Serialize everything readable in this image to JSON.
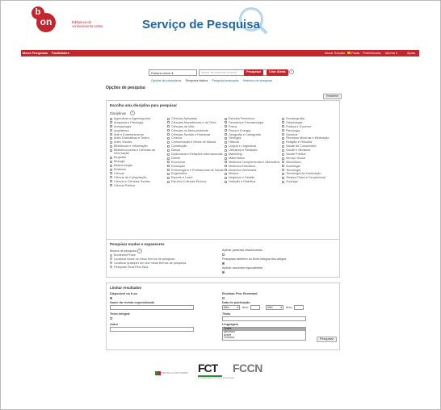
{
  "header": {
    "logo_b": "b",
    "logo_on": "on",
    "logo_line1": "Biblioteca do",
    "logo_line2": "conhecimento online",
    "title": "Serviço de Pesquisa"
  },
  "nav": {
    "left": [
      "Meus Pesquisas",
      "Facilidades"
    ],
    "right": [
      "Iniciar Sessão",
      "Pasta",
      "Preferências",
      "Idioma ▾",
      "Ajuda"
    ]
  },
  "search": {
    "select_value": "Palavra-chave ▾",
    "placeholder": "Inserir as palavras-chaves",
    "search_button": "Pesquisar",
    "alert_button": "Criar Alerta",
    "help": "?"
  },
  "sub_links": [
    "Opções de pesquisa ▸",
    "Pesquisa básica",
    "Pesquisa avançada",
    "Histórico de pesquisa"
  ],
  "options_heading": "Opções de pesquisa",
  "reset_button": "Redefinir",
  "disciplines": {
    "title": "Escolha uma disciplina para pesquisar",
    "label": "Disciplinas",
    "help": "?",
    "col1": [
      "Agricultura e Agronegócios",
      "Anatomia e Fisiologia",
      "Antropologia",
      "Arquitetura",
      "Arte e Entretenimento",
      "Artes Dramáticas e Teatro",
      "Artes Visuais",
      "Bibliotecas e Informação",
      "Biblioteconomia e Ciências da Informação",
      "Biografia",
      "Biologia",
      "Biotecnologia",
      "Botânica",
      "Ciência",
      "Ciência da Computação",
      "Ciência e Ciências Sociais",
      "Ciência Política"
    ],
    "col2": [
      "Ciências Aplicadas",
      "Ciências Atmosféricas e da Terra",
      "Ciências da Vida",
      "Ciências do Meio-ambiente",
      "Ciências Sociais e Humanas",
      "Cinema",
      "Comunicação e Meios de Massa",
      "Construção",
      "Dança",
      "Diplomacia e Relações Internacionais",
      "Direito",
      "Economia",
      "Educação",
      "Enfermagem e Profissionais de Saúde",
      "Engenharia",
      "Esporte e Lazer",
      "Estudos Culturais Étnicos"
    ],
    "col3": [
      "Estudos Femininos",
      "Farmácia e Farmacologia",
      "Física",
      "Fisica e Energia",
      "Geografia e Cartografia",
      "Geologia",
      "História",
      "Língua e Linguística",
      "Literatura e Redação",
      "Marketing",
      "Matemática",
      "Medicina Complementar e Alternativa",
      "Medicina Educativa",
      "Medicina Veterinária",
      "Música",
      "Negócios e Gestão",
      "Nutrição e Dietética"
    ],
    "col4": [
      "Oceanografia",
      "Odontologia",
      "Política e Governo",
      "Psicologia",
      "Química",
      "Recursos Minerais e Mineração",
      "Religião e Filosofia",
      "Saúde do Consumidor",
      "Saúde e Medicina",
      "Saúde Pública",
      "Serviço Social",
      "Silvicultura",
      "Sociologia",
      "Tecnologia",
      "Tecnologia da Informação",
      "Terapia Física e Ocupacional",
      "Zoologia"
    ]
  },
  "modes": {
    "title": "Pesquisar modos e expansores",
    "modes_label": "Modos de pesquisa",
    "help": "?",
    "options": [
      "Booleano/Frase",
      "Localizar todos os meus termos de pesquisa",
      "Localizar qualquer um dos meus termos de pesquisa",
      "Pesquisa SmartText"
    ],
    "smarttext_link": "Dica",
    "expand1": "Aplicar palavras relacionadas",
    "expand2": "Pesquisar também no texto integral dos artigos",
    "expand3": "Aplicar assuntos equivalentes"
  },
  "limits": {
    "title": "Limitar resultados",
    "available": "Disponível na b-on",
    "peer": "Revistas Peer Reviewed",
    "journal": "Nome da revista especializada",
    "pubdate": "Data de publicação",
    "month1": "Mês",
    "year1": "Ano:",
    "dash": "-",
    "month2": "Mês",
    "year2": "Ano:",
    "fulltext": "Texto integral",
    "title_field": "Título",
    "author": "Autor",
    "language": "Linguagem",
    "languages": [
      "Todos",
      "Africâner",
      "Árabe",
      "Chinesa"
    ],
    "search_button": "Pesquisar"
  },
  "footer": {
    "gov": "REPÚBLICA PORTUGUESA",
    "fct": "FCT",
    "fct_sub": "Fundação para a Ciência e a Tecnologia",
    "fccn": "FCCN"
  }
}
